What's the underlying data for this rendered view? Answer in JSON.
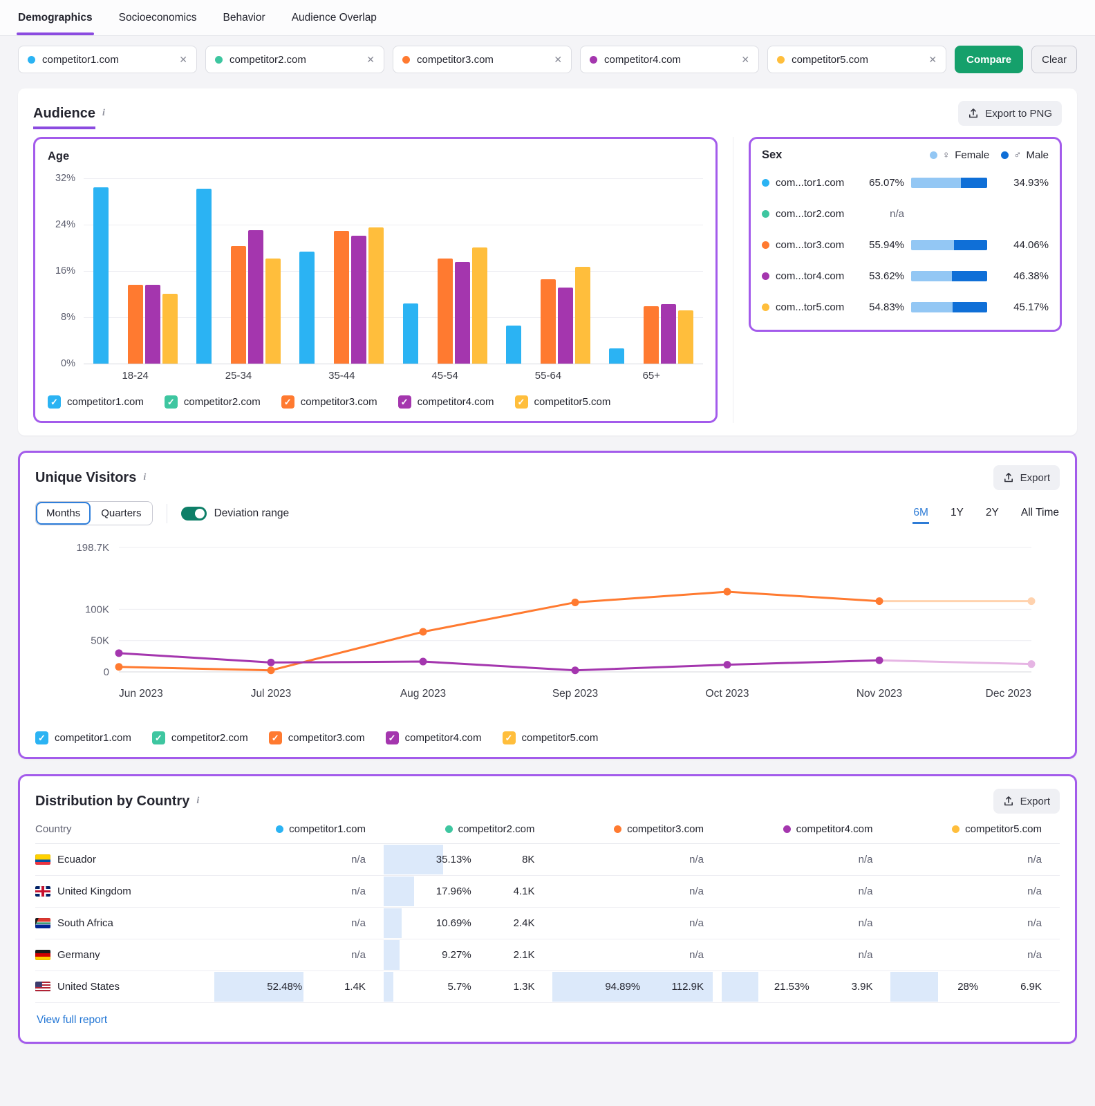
{
  "nav": {
    "tabs": [
      {
        "label": "Demographics",
        "active": true
      },
      {
        "label": "Socioeconomics",
        "active": false
      },
      {
        "label": "Behavior",
        "active": false
      },
      {
        "label": "Audience Overlap",
        "active": false
      }
    ]
  },
  "competitors": [
    {
      "name": "competitor1.com",
      "color": "#2BB3F3"
    },
    {
      "name": "competitor2.com",
      "color": "#3EC6A0"
    },
    {
      "name": "competitor3.com",
      "color": "#FF7A30"
    },
    {
      "name": "competitor4.com",
      "color": "#A436AE"
    },
    {
      "name": "competitor5.com",
      "color": "#FFBE3C"
    }
  ],
  "actions": {
    "compare": "Compare",
    "clear": "Clear"
  },
  "audience": {
    "title": "Audience",
    "export_label": "Export to PNG"
  },
  "age_chart": {
    "type": "bar",
    "title": "Age",
    "categories": [
      "18-24",
      "25-34",
      "35-44",
      "45-54",
      "55-64",
      "65+"
    ],
    "yticks": [
      "32%",
      "24%",
      "16%",
      "8%",
      "0%"
    ],
    "ymax": 32,
    "ylabel": "share of audience (%)",
    "series": [
      {
        "name": "competitor1.com",
        "color": "#2BB3F3",
        "values": [
          30.5,
          30.2,
          19.4,
          10.4,
          6.6,
          2.6
        ]
      },
      {
        "name": "competitor2.com",
        "color": "#3EC6A0",
        "values": null
      },
      {
        "name": "competitor3.com",
        "color": "#FF7A30",
        "values": [
          13.6,
          20.3,
          22.9,
          18.1,
          14.6,
          9.9
        ]
      },
      {
        "name": "competitor4.com",
        "color": "#A436AE",
        "values": [
          13.6,
          23.1,
          22.1,
          17.5,
          13.1,
          10.3
        ]
      },
      {
        "name": "competitor5.com",
        "color": "#FFBE3C",
        "values": [
          12.1,
          18.2,
          23.5,
          20.1,
          16.7,
          9.2
        ]
      }
    ]
  },
  "sex": {
    "title": "Sex",
    "legend": {
      "female": "Female",
      "male": "Male"
    },
    "female_color": "#93C7F4",
    "male_color": "#0F6FD7",
    "rows": [
      {
        "name": "com...tor1.com",
        "color": "#2BB3F3",
        "female": "65.07%",
        "male": "34.93%",
        "female_pct": 65.07
      },
      {
        "name": "com...tor2.com",
        "color": "#3EC6A0",
        "na": "n/a"
      },
      {
        "name": "com...tor3.com",
        "color": "#FF7A30",
        "female": "55.94%",
        "male": "44.06%",
        "female_pct": 55.94
      },
      {
        "name": "com...tor4.com",
        "color": "#A436AE",
        "female": "53.62%",
        "male": "46.38%",
        "female_pct": 53.62
      },
      {
        "name": "com...tor5.com",
        "color": "#FFBE3C",
        "female": "54.83%",
        "male": "45.17%",
        "female_pct": 54.83
      }
    ]
  },
  "visitors": {
    "title": "Unique Visitors",
    "export_label": "Export",
    "granularity": [
      {
        "label": "Months",
        "active": true
      },
      {
        "label": "Quarters",
        "active": false
      }
    ],
    "deviation_label": "Deviation range",
    "deviation_on": true,
    "ranges": [
      {
        "label": "6M",
        "active": true
      },
      {
        "label": "1Y",
        "active": false
      },
      {
        "label": "2Y",
        "active": false
      },
      {
        "label": "All Time",
        "active": false
      }
    ]
  },
  "visitors_chart": {
    "type": "line",
    "x": [
      "Jun 2023",
      "Jul 2023",
      "Aug 2023",
      "Sep 2023",
      "Oct 2023",
      "Nov 2023",
      "Dec 2023"
    ],
    "yticks": [
      {
        "label": "198.7K",
        "value": 198700
      },
      {
        "label": "100K",
        "value": 100000
      },
      {
        "label": "50K",
        "value": 50000
      },
      {
        "label": "0",
        "value": 0
      }
    ],
    "ymax": 198700,
    "series": [
      {
        "name": "competitor3.com",
        "color": "#FF7A30",
        "muted_color": "#FFD2AE",
        "projected_from": 5,
        "values": [
          8000,
          2500,
          64000,
          111000,
          128000,
          113000,
          113000
        ]
      },
      {
        "name": "competitor4.com",
        "color": "#A436AE",
        "muted_color": "#E6B5E4",
        "projected_from": 5,
        "values": [
          30000,
          15000,
          16500,
          2500,
          11500,
          18500,
          12500
        ]
      }
    ]
  },
  "country": {
    "title": "Distribution by Country",
    "export_label": "Export",
    "col_country": "Country",
    "view_full_report": "View full report",
    "rows": [
      {
        "country": "Ecuador",
        "flag": "ecuador",
        "values": [
          {
            "na": true
          },
          {
            "pct": "35.13%",
            "abs": "8K",
            "fill": 35.13
          },
          {
            "na": true
          },
          {
            "na": true
          },
          {
            "na": true
          }
        ]
      },
      {
        "country": "United Kingdom",
        "flag": "uk",
        "values": [
          {
            "na": true
          },
          {
            "pct": "17.96%",
            "abs": "4.1K",
            "fill": 17.96
          },
          {
            "na": true
          },
          {
            "na": true
          },
          {
            "na": true
          }
        ]
      },
      {
        "country": "South Africa",
        "flag": "south-africa",
        "values": [
          {
            "na": true
          },
          {
            "pct": "10.69%",
            "abs": "2.4K",
            "fill": 10.69
          },
          {
            "na": true
          },
          {
            "na": true
          },
          {
            "na": true
          }
        ]
      },
      {
        "country": "Germany",
        "flag": "germany",
        "values": [
          {
            "na": true
          },
          {
            "pct": "9.27%",
            "abs": "2.1K",
            "fill": 9.27
          },
          {
            "na": true
          },
          {
            "na": true
          },
          {
            "na": true
          }
        ]
      },
      {
        "country": "United States",
        "flag": "usa",
        "values": [
          {
            "pct": "52.48%",
            "abs": "1.4K",
            "fill": 52.48
          },
          {
            "pct": "5.7%",
            "abs": "1.3K",
            "fill": 5.7
          },
          {
            "pct": "94.89%",
            "abs": "112.9K",
            "fill": 94.89
          },
          {
            "pct": "21.53%",
            "abs": "3.9K",
            "fill": 21.53
          },
          {
            "pct": "28%",
            "abs": "6.9K",
            "fill": 28
          }
        ]
      }
    ]
  }
}
